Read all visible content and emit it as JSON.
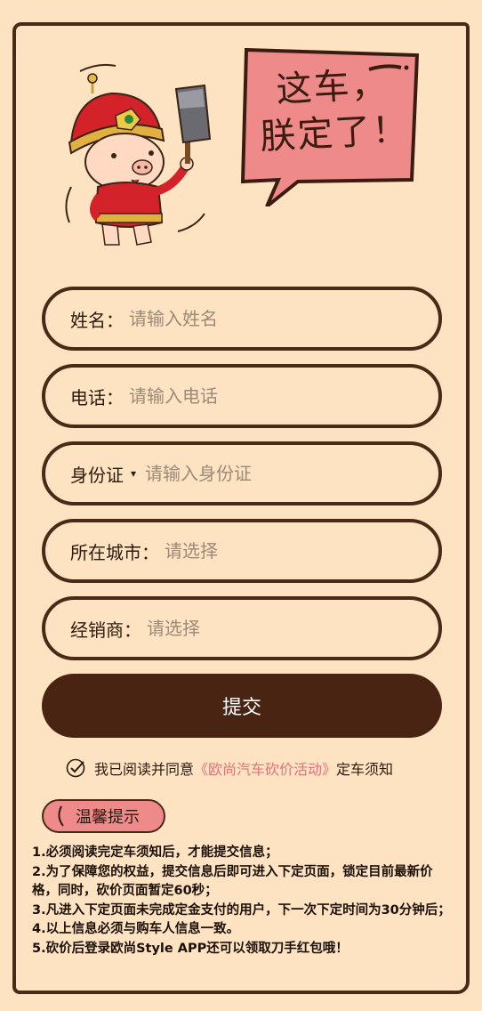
{
  "bubble": {
    "line1": "这车，",
    "line2": "朕定了！"
  },
  "form": {
    "name": {
      "label": "姓名：",
      "placeholder": "请输入姓名"
    },
    "phone": {
      "label": "电话：",
      "placeholder": "请输入电话"
    },
    "id": {
      "label": "身份证",
      "caret": "▾",
      "placeholder": "请输入身份证"
    },
    "city": {
      "label": "所在城市：",
      "placeholder": "请选择"
    },
    "dealer": {
      "label": "经销商：",
      "placeholder": "请选择"
    },
    "submit_label": "提交"
  },
  "agreement": {
    "prefix": "我已阅读并同意",
    "link": "《欧尚汽车砍价活动》",
    "suffix": "定车须知"
  },
  "tips": {
    "title": "温馨提示",
    "items": [
      "1.必须阅读完定车须知后，才能提交信息；",
      "2.为了保障您的权益，提交信息后即可进入下定页面，锁定目前最新价格，同时，砍价页面暂定60秒；",
      "3.凡进入下定页面未完成定金支付的用户，下一次下定时间为30分钟后；",
      "4.以上信息必须与购车人信息一致。",
      "5.砍价后登录欧尚Style APP还可以领取刀手红包哦！"
    ]
  },
  "colors": {
    "background": "#fde3c2",
    "border": "#4a2a17",
    "submit": "#4a2412",
    "link": "#e8707a",
    "badge": "#ef8a8b"
  }
}
